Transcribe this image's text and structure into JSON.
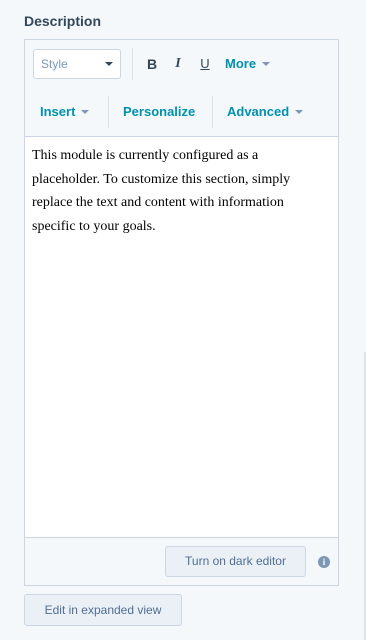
{
  "field": {
    "label": "Description"
  },
  "toolbar": {
    "style_select": {
      "value": "Style"
    },
    "bold_label": "B",
    "italic_label": "I",
    "underline_label": "U",
    "more_label": "More",
    "insert_label": "Insert",
    "personalize_label": "Personalize",
    "advanced_label": "Advanced"
  },
  "content": {
    "text": "This module is currently configured as a placeholder. To customize this section, simply replace the text and content with information specific to your goals."
  },
  "footer": {
    "dark_editor_label": "Turn on dark editor",
    "info_icon": "i"
  },
  "expand_label": "Edit in expanded view",
  "icons": {
    "caret": "chevron-down-icon",
    "info": "info-icon"
  },
  "colors": {
    "accent": "#0091ae",
    "text": "#33475b",
    "border": "#cbd6e2",
    "background": "#f5f8fa"
  }
}
